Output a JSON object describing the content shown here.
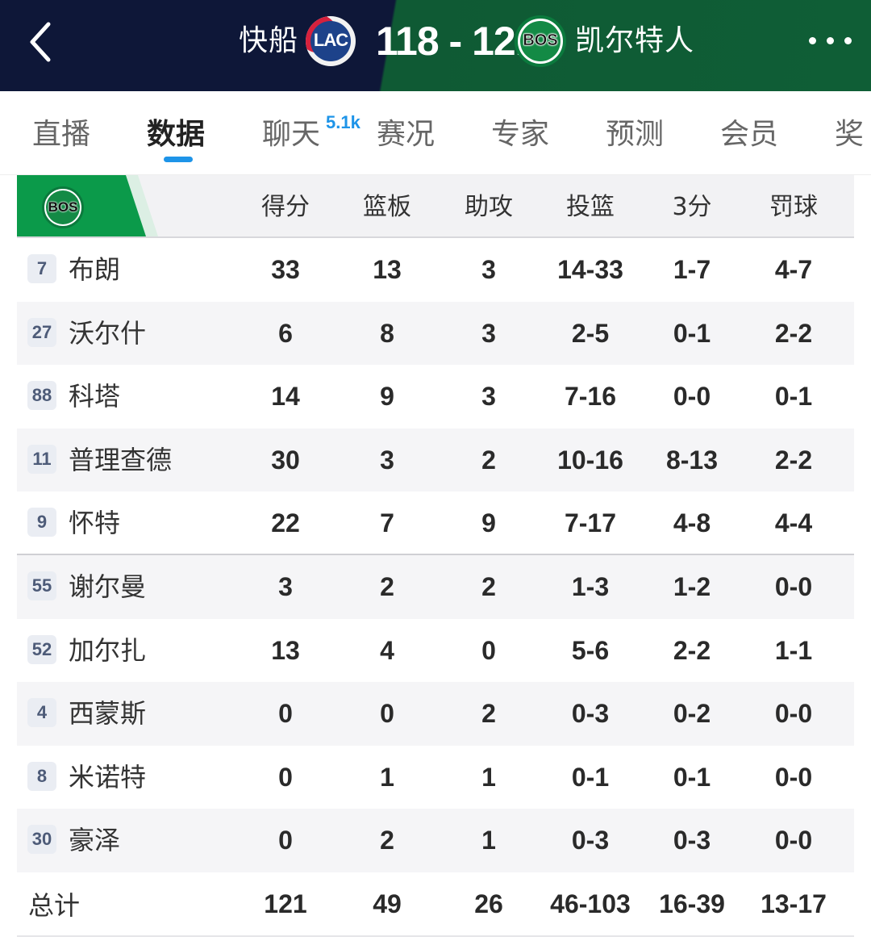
{
  "header": {
    "home_team": "快船",
    "home_logo": "LAC",
    "score": "118 - 121",
    "away_team": "凯尔特人",
    "away_logo": "BOS",
    "colors": {
      "left_bg": "#0e1738",
      "right_bg": "#0f5e36"
    }
  },
  "tabs": [
    {
      "label": "直播"
    },
    {
      "label": "数据",
      "active": true
    },
    {
      "label": "聊天",
      "badge": "5.1k"
    },
    {
      "label": "赛况"
    },
    {
      "label": "专家"
    },
    {
      "label": "预测"
    },
    {
      "label": "会员"
    },
    {
      "label": "奖"
    }
  ],
  "table": {
    "team_logo": "BOS",
    "columns": [
      "得分",
      "篮板",
      "助攻",
      "投篮",
      "3分",
      "罚球"
    ],
    "players": [
      {
        "number": "7",
        "name": "布朗",
        "stats": [
          "33",
          "13",
          "3",
          "14-33",
          "1-7",
          "4-7"
        ]
      },
      {
        "number": "27",
        "name": "沃尔什",
        "stats": [
          "6",
          "8",
          "3",
          "2-5",
          "0-1",
          "2-2"
        ]
      },
      {
        "number": "88",
        "name": "科塔",
        "stats": [
          "14",
          "9",
          "3",
          "7-16",
          "0-0",
          "0-1"
        ]
      },
      {
        "number": "11",
        "name": "普理查德",
        "stats": [
          "30",
          "3",
          "2",
          "10-16",
          "8-13",
          "2-2"
        ]
      },
      {
        "number": "9",
        "name": "怀特",
        "stats": [
          "22",
          "7",
          "9",
          "7-17",
          "4-8",
          "4-4"
        ]
      },
      {
        "number": "55",
        "name": "谢尔曼",
        "stats": [
          "3",
          "2",
          "2",
          "1-3",
          "1-2",
          "0-0"
        ]
      },
      {
        "number": "52",
        "name": "加尔扎",
        "stats": [
          "13",
          "4",
          "0",
          "5-6",
          "2-2",
          "1-1"
        ]
      },
      {
        "number": "4",
        "name": "西蒙斯",
        "stats": [
          "0",
          "0",
          "2",
          "0-3",
          "0-2",
          "0-0"
        ]
      },
      {
        "number": "8",
        "name": "米诺特",
        "stats": [
          "0",
          "1",
          "1",
          "0-1",
          "0-1",
          "0-0"
        ]
      },
      {
        "number": "30",
        "name": "豪泽",
        "stats": [
          "0",
          "2",
          "1",
          "0-3",
          "0-3",
          "0-0"
        ]
      }
    ],
    "total": {
      "label": "总计",
      "stats": [
        "121",
        "49",
        "26",
        "46-103",
        "16-39",
        "13-17"
      ]
    }
  }
}
